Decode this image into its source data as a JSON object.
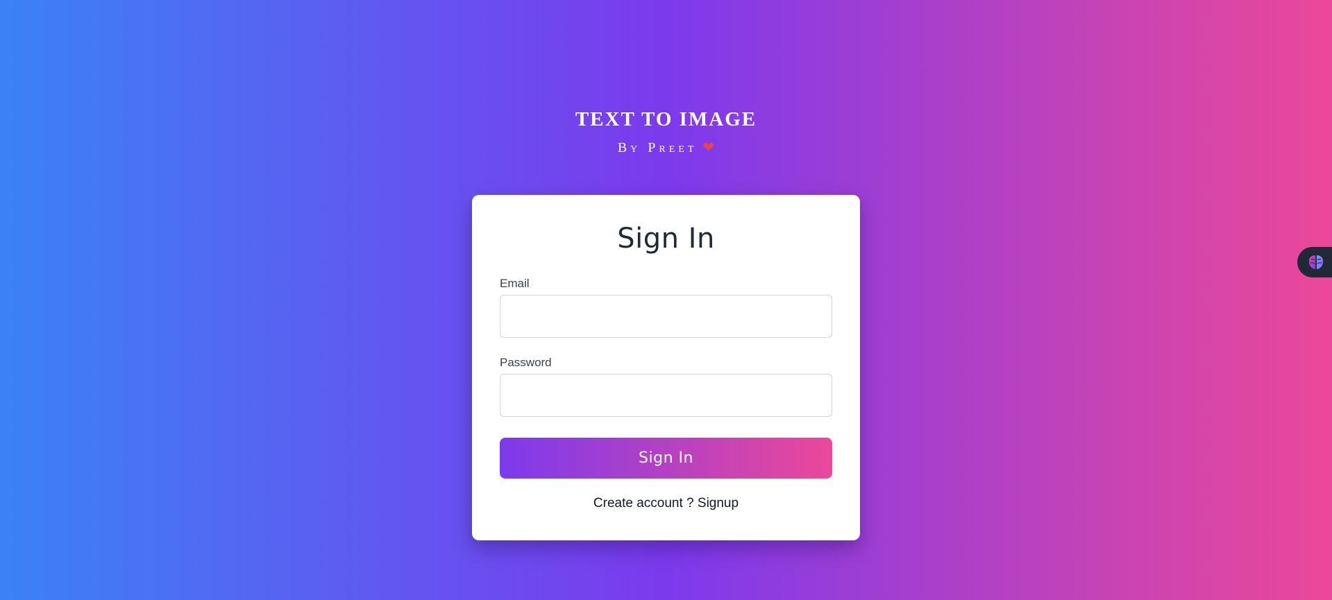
{
  "brand": {
    "title": "TEXT TO IMAGE",
    "subtitle": "By Preet",
    "subtitle_icon": "heart-icon"
  },
  "form": {
    "heading": "Sign In",
    "email_label": "Email",
    "email_value": "",
    "password_label": "Password",
    "password_value": "",
    "submit_label": "Sign In",
    "signup_prompt": "Create account ?",
    "signup_link": "Signup"
  },
  "widget": {
    "icon": "brain-icon"
  },
  "colors": {
    "gradient_start": "#3b82f6",
    "gradient_mid": "#7c3aed",
    "gradient_end": "#ec4899",
    "heart": "#ef4444"
  }
}
